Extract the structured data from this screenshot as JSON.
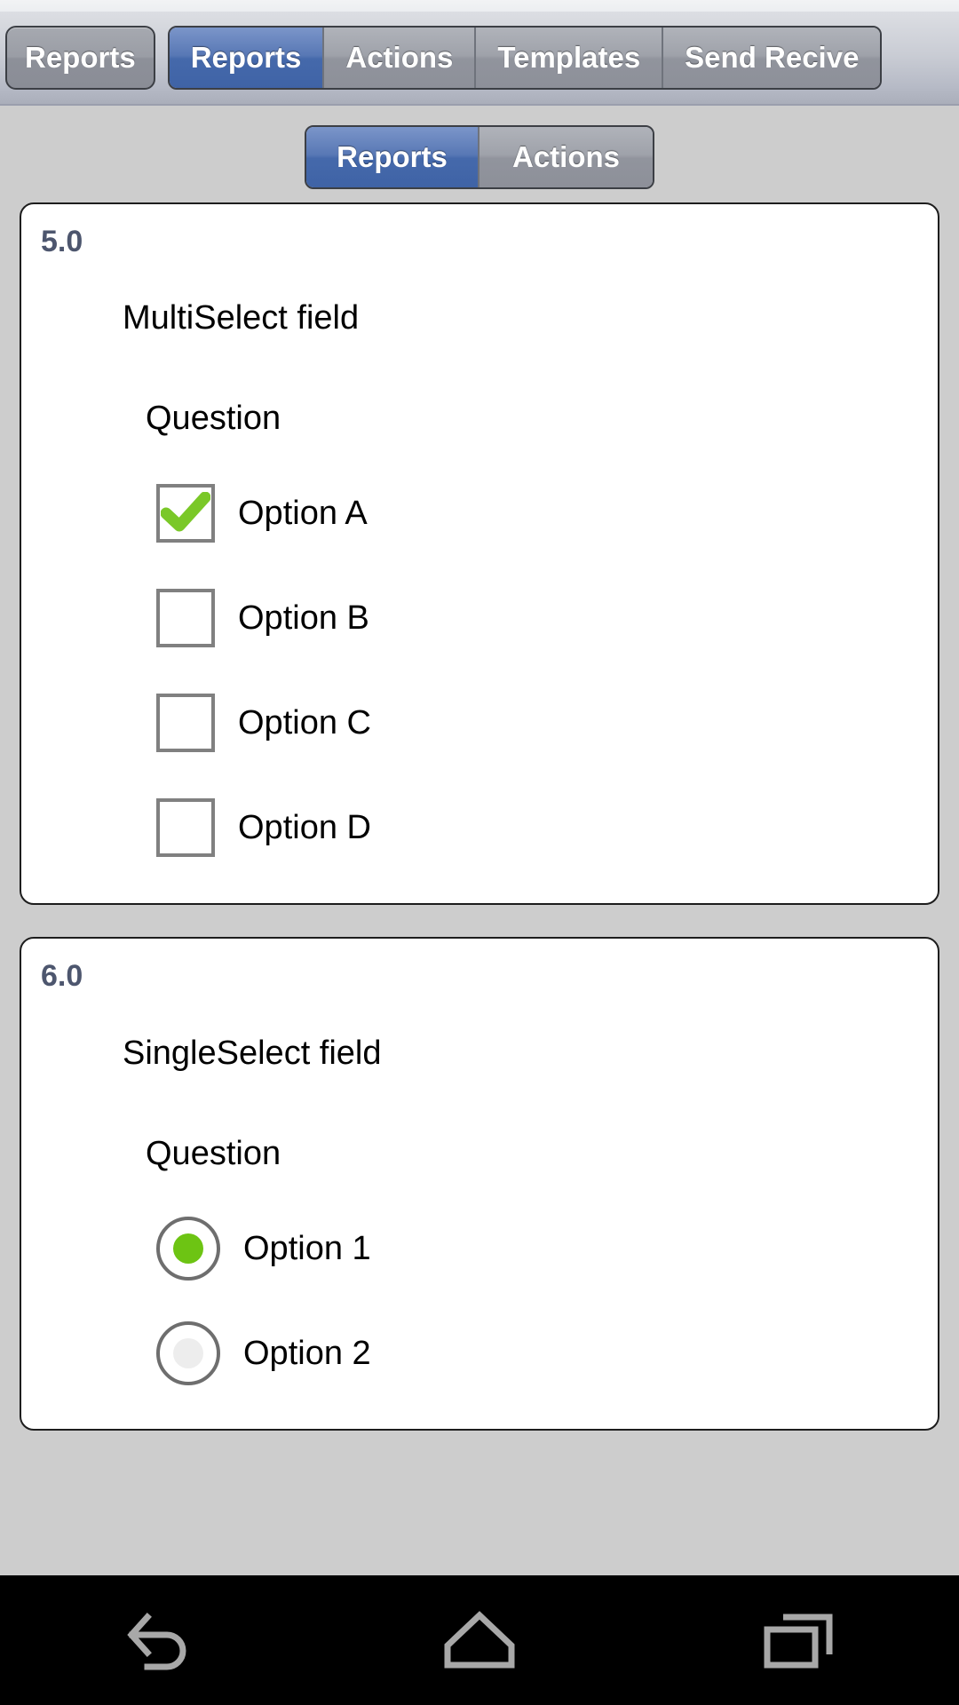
{
  "app_bar": {
    "home_button_label": "Reports",
    "segments": [
      {
        "label": "Reports",
        "state": "active"
      },
      {
        "label": "Actions",
        "state": "inactive"
      },
      {
        "label": "Templates",
        "state": "inactive"
      },
      {
        "label": "Send Recive",
        "state": "inactive"
      }
    ]
  },
  "sub_tabs": [
    {
      "label": "Reports",
      "state": "active"
    },
    {
      "label": "Actions",
      "state": "inactive"
    }
  ],
  "cards": [
    {
      "number": "5.0",
      "field_title": "MultiSelect field",
      "question_label": "Question",
      "control": "checkbox",
      "options": [
        {
          "label": "Option A",
          "checked": true
        },
        {
          "label": "Option B",
          "checked": false
        },
        {
          "label": "Option C",
          "checked": false
        },
        {
          "label": "Option D",
          "checked": false
        }
      ]
    },
    {
      "number": "6.0",
      "field_title": "SingleSelect field",
      "question_label": "Question",
      "control": "radio",
      "options": [
        {
          "label": "Option 1",
          "checked": true
        },
        {
          "label": "Option 2",
          "checked": false
        }
      ]
    }
  ],
  "nav_bar": {
    "buttons": [
      {
        "icon": "back-icon"
      },
      {
        "icon": "home-icon"
      },
      {
        "icon": "recents-icon"
      }
    ]
  },
  "colors": {
    "accent_blue": "#4569ab",
    "check_green": "#7ac828",
    "radio_green": "#6dc413",
    "card_number": "#4d566e",
    "page_background": "#cdcdcd",
    "nav_icon": "#a8a8a8"
  }
}
